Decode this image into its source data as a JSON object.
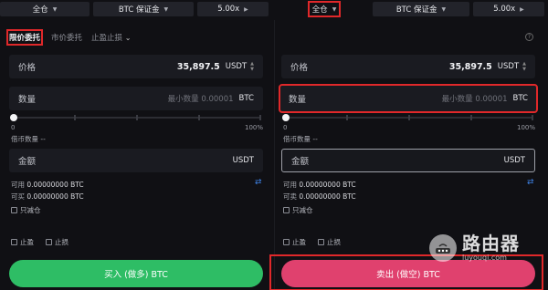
{
  "top": {
    "left": {
      "margin_mode": "全仓",
      "margin_asset": "BTC 保证金",
      "leverage": "5.00x"
    },
    "right": {
      "margin_mode": "全仓",
      "margin_asset": "BTC 保证金",
      "leverage": "5.00x"
    }
  },
  "order_tabs": {
    "limit": "限价委托",
    "market": "市价委托",
    "stop": "止盈止损"
  },
  "buy_panel": {
    "price_label": "价格",
    "price_value": "35,897.5",
    "price_unit": "USDT",
    "qty_label": "数量",
    "qty_placeholder": "最小数量 0.00001",
    "qty_unit": "BTC",
    "slider_min": "0",
    "slider_max": "100%",
    "borrow_label": "借币数量 --",
    "amount_label": "金额",
    "amount_unit": "USDT",
    "available": "可用",
    "available_value": "0.00000000 BTC",
    "can_buy": "可买",
    "can_buy_value": "0.00000000 BTC",
    "reduce_only": "只减仓",
    "take_profit": "止盈",
    "stop_loss": "止损",
    "action": "买入 (做多) BTC"
  },
  "sell_panel": {
    "price_label": "价格",
    "price_value": "35,897.5",
    "price_unit": "USDT",
    "qty_label": "数量",
    "qty_placeholder": "最小数量 0.00001",
    "qty_unit": "BTC",
    "slider_min": "0",
    "slider_max": "100%",
    "borrow_label": "借币数量 --",
    "amount_label": "金额",
    "amount_unit": "USDT",
    "available": "可用",
    "available_value": "0.00000000 BTC",
    "can_sell": "可卖",
    "can_sell_value": "0.00000000 BTC",
    "reduce_only": "只减仓",
    "take_profit": "止盈",
    "stop_loss": "止损",
    "action": "卖出 (做空) BTC"
  },
  "watermark": {
    "title": "路由器",
    "url": "luyouqi.com"
  },
  "colors": {
    "buy": "#2ebd65",
    "sell": "#e0416e",
    "highlight": "#e0282a",
    "link": "#3d7fe0"
  }
}
